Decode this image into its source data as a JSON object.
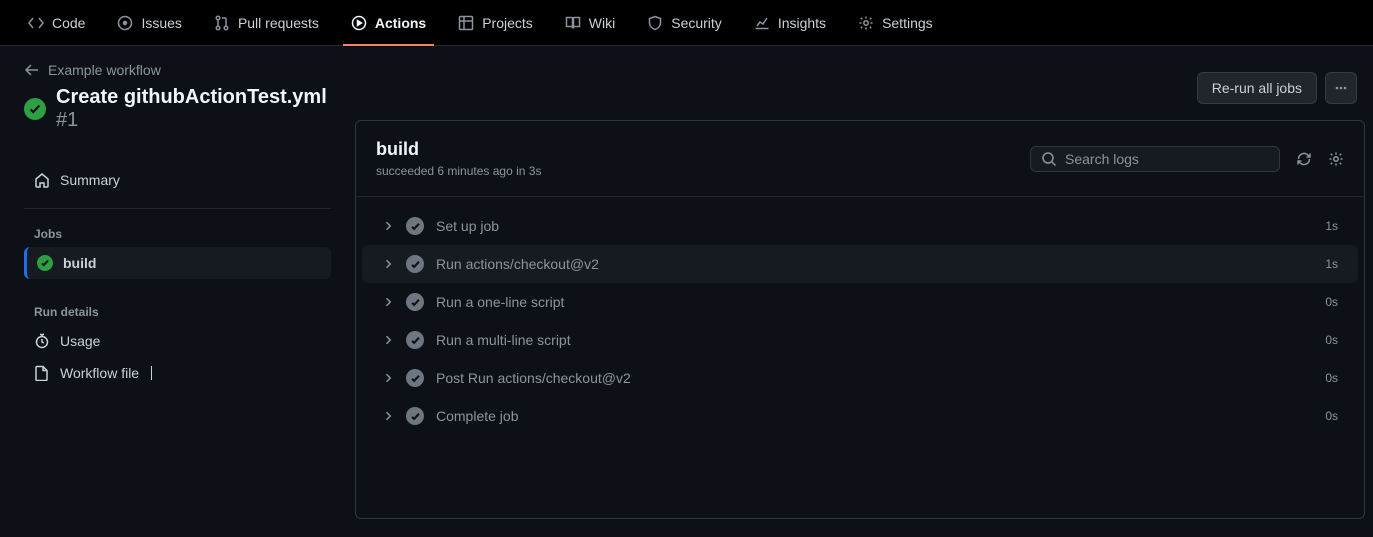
{
  "topnav": [
    {
      "label": "Code"
    },
    {
      "label": "Issues"
    },
    {
      "label": "Pull requests"
    },
    {
      "label": "Actions",
      "active": true
    },
    {
      "label": "Projects"
    },
    {
      "label": "Wiki"
    },
    {
      "label": "Security"
    },
    {
      "label": "Insights"
    },
    {
      "label": "Settings"
    }
  ],
  "back_label": "Example workflow",
  "run": {
    "title": "Create githubActionTest.yml",
    "number": "#1"
  },
  "sidebar": {
    "summary": "Summary",
    "jobs_heading": "Jobs",
    "job_name": "build",
    "run_details_heading": "Run details",
    "usage": "Usage",
    "workflow_file": "Workflow file"
  },
  "header_actions": {
    "rerun": "Re-run all jobs"
  },
  "panel": {
    "title": "build",
    "sub": "succeeded 6 minutes ago in 3s",
    "search_placeholder": "Search logs"
  },
  "steps": [
    {
      "name": "Set up job",
      "time": "1s",
      "hover": false
    },
    {
      "name": "Run actions/checkout@v2",
      "time": "1s",
      "hover": true
    },
    {
      "name": "Run a one-line script",
      "time": "0s",
      "hover": false
    },
    {
      "name": "Run a multi-line script",
      "time": "0s",
      "hover": false
    },
    {
      "name": "Post Run actions/checkout@v2",
      "time": "0s",
      "hover": false
    },
    {
      "name": "Complete job",
      "time": "0s",
      "hover": false
    }
  ]
}
